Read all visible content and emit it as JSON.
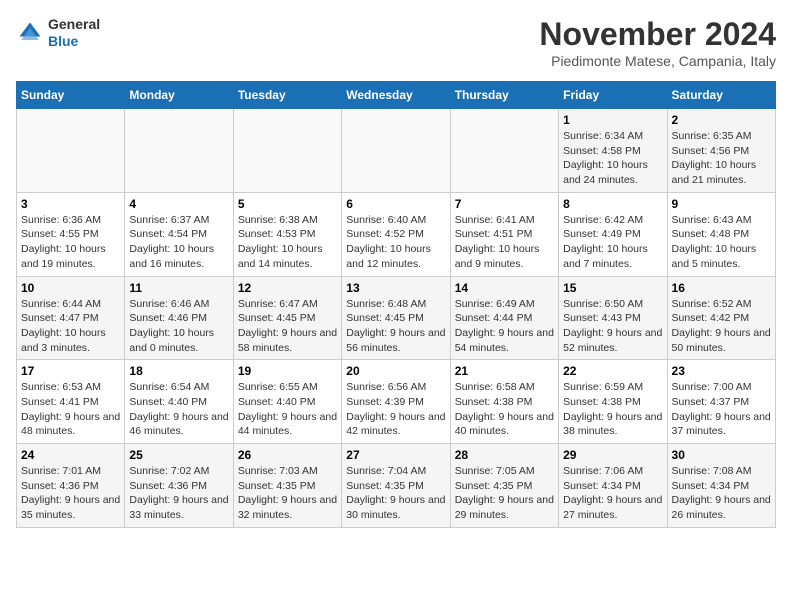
{
  "logo": {
    "line1": "General",
    "line2": "Blue"
  },
  "title": "November 2024",
  "location": "Piedimonte Matese, Campania, Italy",
  "weekdays": [
    "Sunday",
    "Monday",
    "Tuesday",
    "Wednesday",
    "Thursday",
    "Friday",
    "Saturday"
  ],
  "weeks": [
    [
      {
        "day": "",
        "info": ""
      },
      {
        "day": "",
        "info": ""
      },
      {
        "day": "",
        "info": ""
      },
      {
        "day": "",
        "info": ""
      },
      {
        "day": "",
        "info": ""
      },
      {
        "day": "1",
        "info": "Sunrise: 6:34 AM\nSunset: 4:58 PM\nDaylight: 10 hours and 24 minutes."
      },
      {
        "day": "2",
        "info": "Sunrise: 6:35 AM\nSunset: 4:56 PM\nDaylight: 10 hours and 21 minutes."
      }
    ],
    [
      {
        "day": "3",
        "info": "Sunrise: 6:36 AM\nSunset: 4:55 PM\nDaylight: 10 hours and 19 minutes."
      },
      {
        "day": "4",
        "info": "Sunrise: 6:37 AM\nSunset: 4:54 PM\nDaylight: 10 hours and 16 minutes."
      },
      {
        "day": "5",
        "info": "Sunrise: 6:38 AM\nSunset: 4:53 PM\nDaylight: 10 hours and 14 minutes."
      },
      {
        "day": "6",
        "info": "Sunrise: 6:40 AM\nSunset: 4:52 PM\nDaylight: 10 hours and 12 minutes."
      },
      {
        "day": "7",
        "info": "Sunrise: 6:41 AM\nSunset: 4:51 PM\nDaylight: 10 hours and 9 minutes."
      },
      {
        "day": "8",
        "info": "Sunrise: 6:42 AM\nSunset: 4:49 PM\nDaylight: 10 hours and 7 minutes."
      },
      {
        "day": "9",
        "info": "Sunrise: 6:43 AM\nSunset: 4:48 PM\nDaylight: 10 hours and 5 minutes."
      }
    ],
    [
      {
        "day": "10",
        "info": "Sunrise: 6:44 AM\nSunset: 4:47 PM\nDaylight: 10 hours and 3 minutes."
      },
      {
        "day": "11",
        "info": "Sunrise: 6:46 AM\nSunset: 4:46 PM\nDaylight: 10 hours and 0 minutes."
      },
      {
        "day": "12",
        "info": "Sunrise: 6:47 AM\nSunset: 4:45 PM\nDaylight: 9 hours and 58 minutes."
      },
      {
        "day": "13",
        "info": "Sunrise: 6:48 AM\nSunset: 4:45 PM\nDaylight: 9 hours and 56 minutes."
      },
      {
        "day": "14",
        "info": "Sunrise: 6:49 AM\nSunset: 4:44 PM\nDaylight: 9 hours and 54 minutes."
      },
      {
        "day": "15",
        "info": "Sunrise: 6:50 AM\nSunset: 4:43 PM\nDaylight: 9 hours and 52 minutes."
      },
      {
        "day": "16",
        "info": "Sunrise: 6:52 AM\nSunset: 4:42 PM\nDaylight: 9 hours and 50 minutes."
      }
    ],
    [
      {
        "day": "17",
        "info": "Sunrise: 6:53 AM\nSunset: 4:41 PM\nDaylight: 9 hours and 48 minutes."
      },
      {
        "day": "18",
        "info": "Sunrise: 6:54 AM\nSunset: 4:40 PM\nDaylight: 9 hours and 46 minutes."
      },
      {
        "day": "19",
        "info": "Sunrise: 6:55 AM\nSunset: 4:40 PM\nDaylight: 9 hours and 44 minutes."
      },
      {
        "day": "20",
        "info": "Sunrise: 6:56 AM\nSunset: 4:39 PM\nDaylight: 9 hours and 42 minutes."
      },
      {
        "day": "21",
        "info": "Sunrise: 6:58 AM\nSunset: 4:38 PM\nDaylight: 9 hours and 40 minutes."
      },
      {
        "day": "22",
        "info": "Sunrise: 6:59 AM\nSunset: 4:38 PM\nDaylight: 9 hours and 38 minutes."
      },
      {
        "day": "23",
        "info": "Sunrise: 7:00 AM\nSunset: 4:37 PM\nDaylight: 9 hours and 37 minutes."
      }
    ],
    [
      {
        "day": "24",
        "info": "Sunrise: 7:01 AM\nSunset: 4:36 PM\nDaylight: 9 hours and 35 minutes."
      },
      {
        "day": "25",
        "info": "Sunrise: 7:02 AM\nSunset: 4:36 PM\nDaylight: 9 hours and 33 minutes."
      },
      {
        "day": "26",
        "info": "Sunrise: 7:03 AM\nSunset: 4:35 PM\nDaylight: 9 hours and 32 minutes."
      },
      {
        "day": "27",
        "info": "Sunrise: 7:04 AM\nSunset: 4:35 PM\nDaylight: 9 hours and 30 minutes."
      },
      {
        "day": "28",
        "info": "Sunrise: 7:05 AM\nSunset: 4:35 PM\nDaylight: 9 hours and 29 minutes."
      },
      {
        "day": "29",
        "info": "Sunrise: 7:06 AM\nSunset: 4:34 PM\nDaylight: 9 hours and 27 minutes."
      },
      {
        "day": "30",
        "info": "Sunrise: 7:08 AM\nSunset: 4:34 PM\nDaylight: 9 hours and 26 minutes."
      }
    ]
  ]
}
